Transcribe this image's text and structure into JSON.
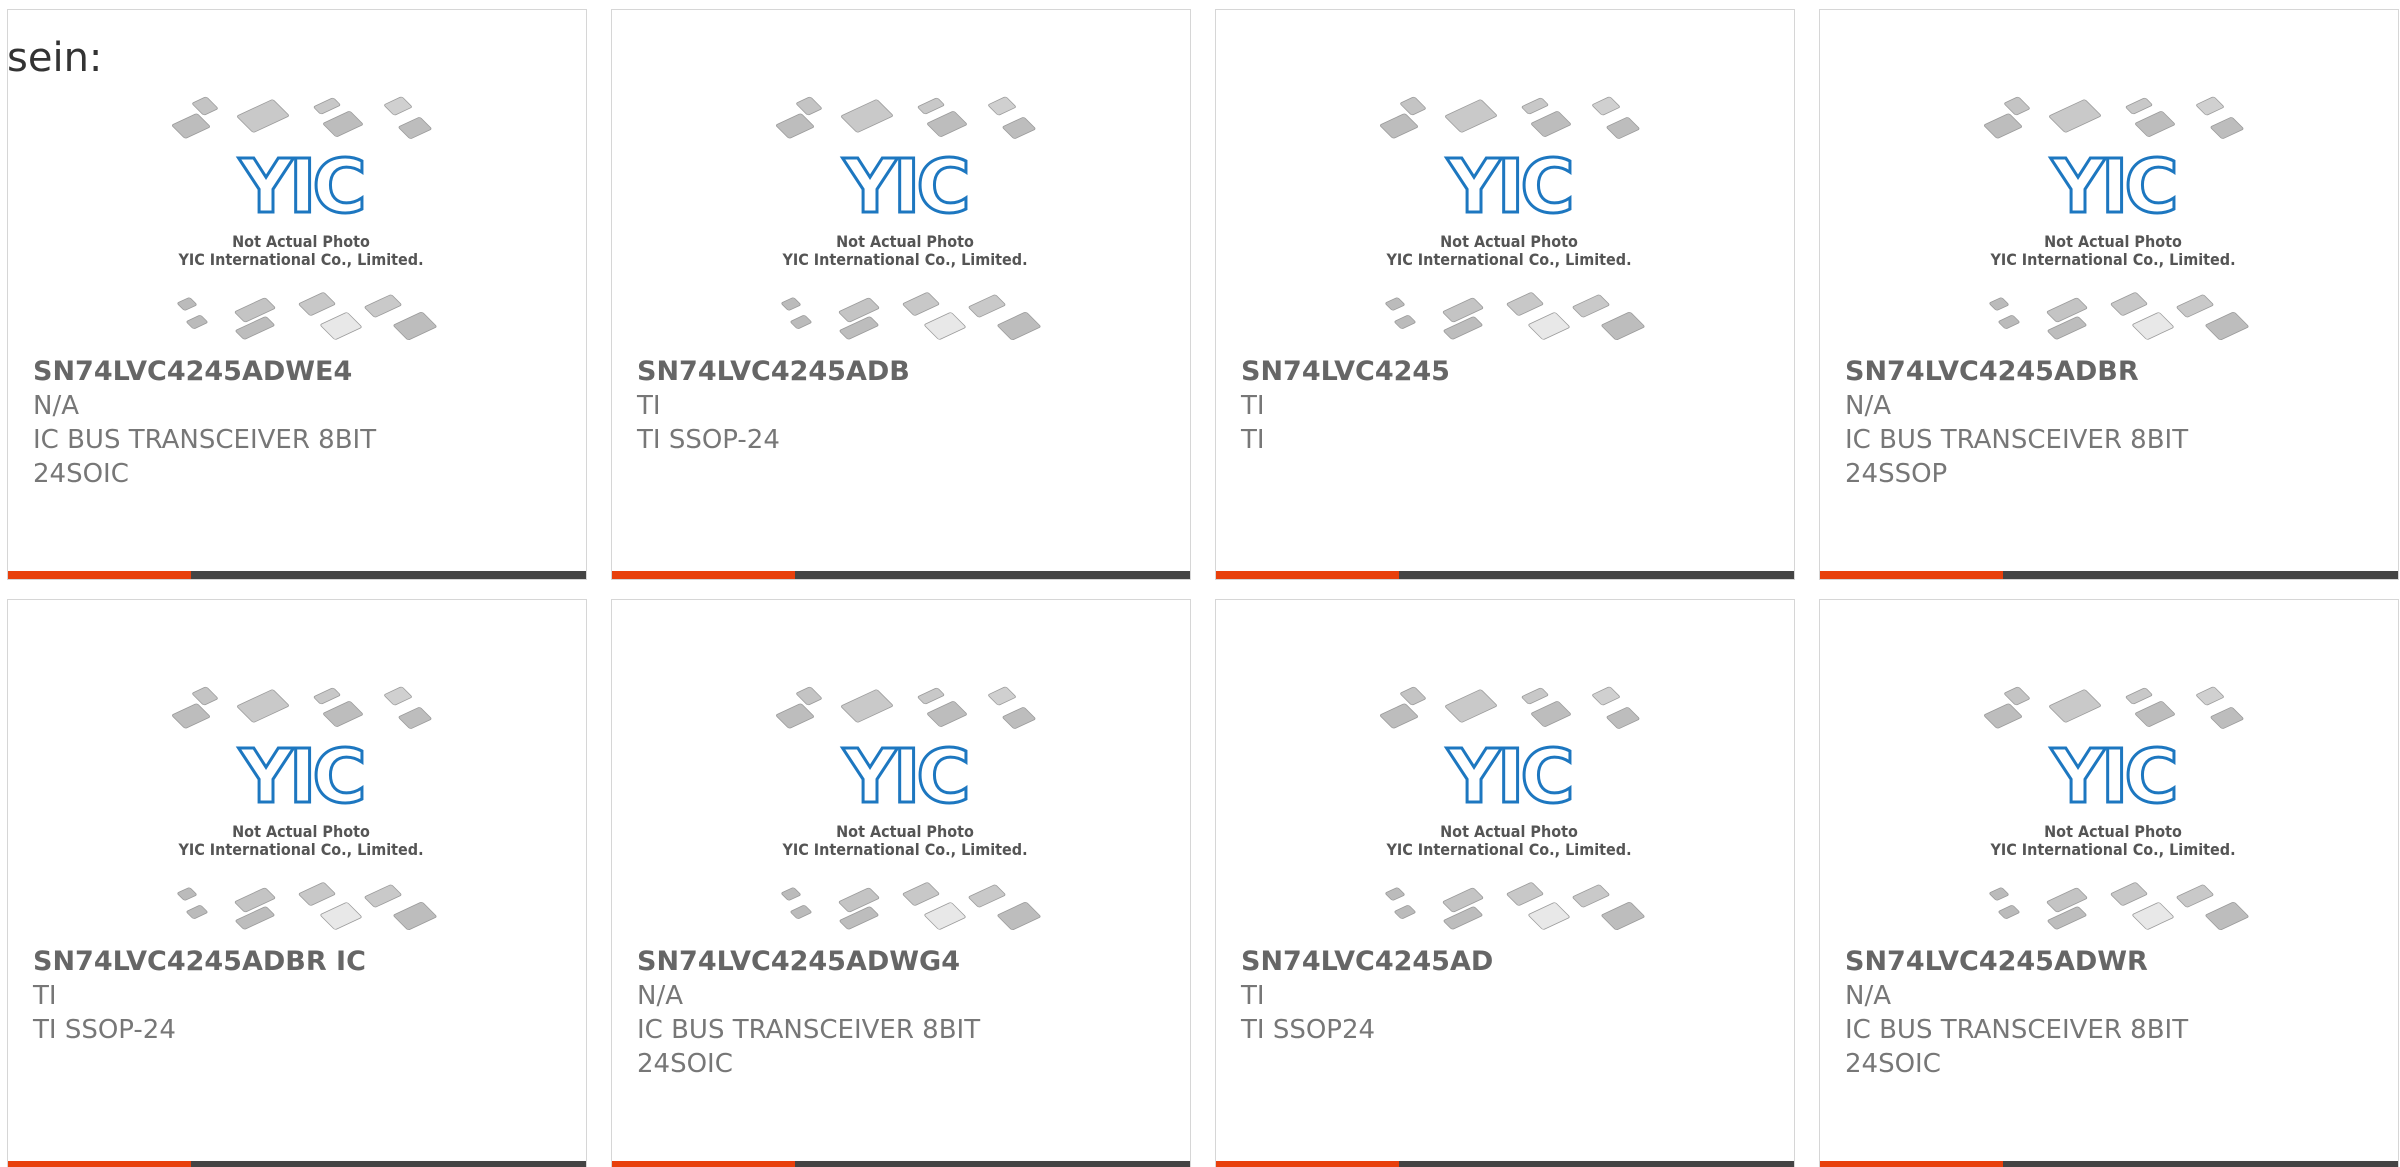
{
  "prefix_text": "sein:",
  "colors": {
    "accent_bar": "#e8400c",
    "dark_bar": "#444444",
    "logo_blue": "#1d77c0"
  },
  "placeholder": {
    "logo_text": "YIC",
    "caption_line1": "Not Actual Photo",
    "caption_line2": "YIC International Co., Limited."
  },
  "products": [
    {
      "part_number": "SN74LVC4245ADWE4",
      "manufacturer": "N/A",
      "description": "IC BUS TRANSCEIVER 8BIT\n24SOIC"
    },
    {
      "part_number": "SN74LVC4245ADB",
      "manufacturer": "TI",
      "description": "TI SSOP-24"
    },
    {
      "part_number": "SN74LVC4245",
      "manufacturer": "TI",
      "description": "TI"
    },
    {
      "part_number": "SN74LVC4245ADBR",
      "manufacturer": "N/A",
      "description": "IC BUS TRANSCEIVER 8BIT\n24SSOP"
    },
    {
      "part_number": "SN74LVC4245ADBR IC",
      "manufacturer": "TI",
      "description": "TI SSOP-24"
    },
    {
      "part_number": "SN74LVC4245ADWG4",
      "manufacturer": "N/A",
      "description": "IC BUS TRANSCEIVER 8BIT\n24SOIC"
    },
    {
      "part_number": "SN74LVC4245AD",
      "manufacturer": "TI",
      "description": "TI SSOP24"
    },
    {
      "part_number": "SN74LVC4245ADWR",
      "manufacturer": "N/A",
      "description": "IC BUS TRANSCEIVER 8BIT\n24SOIC"
    }
  ]
}
